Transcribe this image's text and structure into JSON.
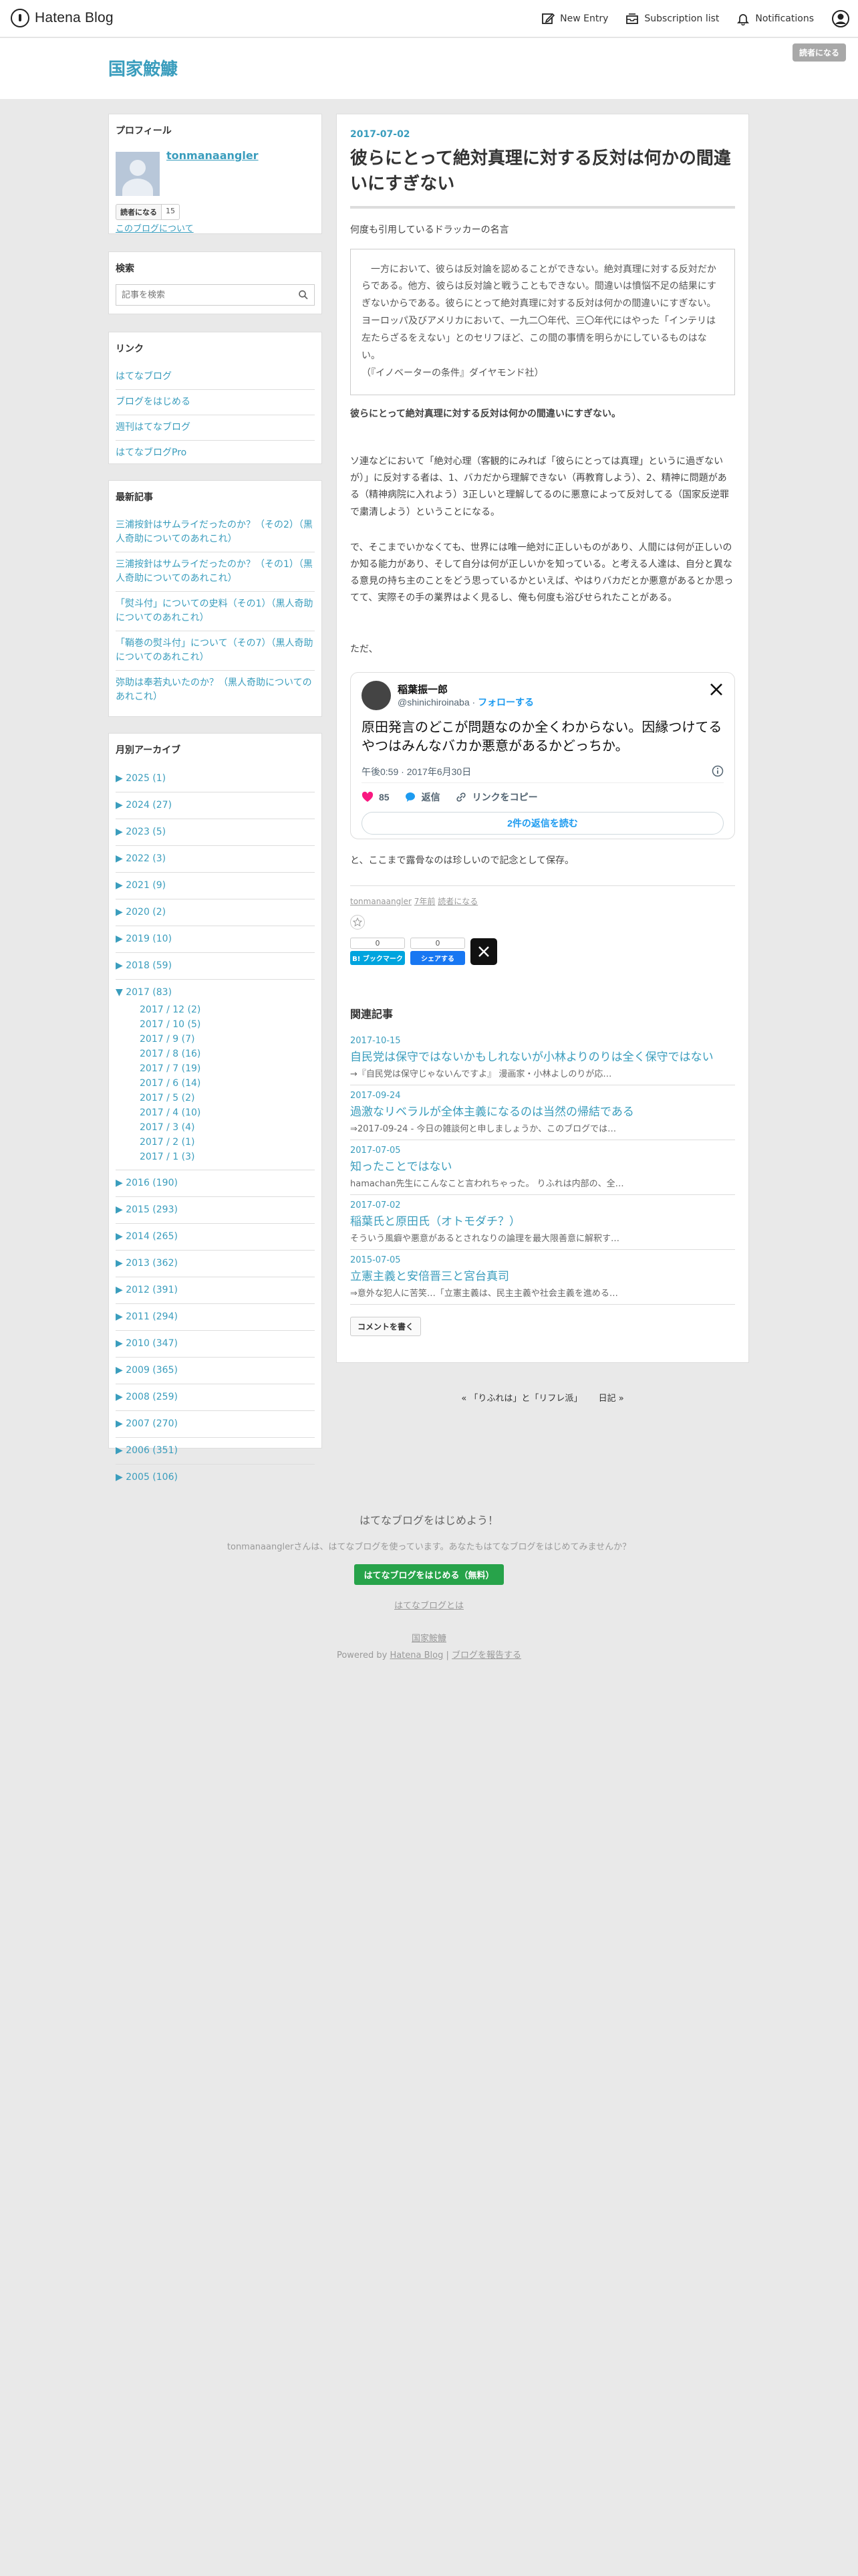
{
  "global_header": {
    "brand": "Hatena Blog",
    "nav": {
      "new_entry": "New Entry",
      "subscription_list": "Subscription list",
      "notifications": "Notifications"
    }
  },
  "blog": {
    "title": "国家鮟鱇",
    "subscribe_button": "読者になる"
  },
  "sidebar": {
    "profile": {
      "heading": "プロフィール",
      "username": "tonmanaangler",
      "follow_label": "読者になる",
      "follow_count": "15",
      "about_link": "このブログについて"
    },
    "search": {
      "heading": "検索",
      "placeholder": "記事を検索"
    },
    "links": {
      "heading": "リンク",
      "items": [
        "はてなブログ",
        "ブログをはじめる",
        "週刊はてなブログ",
        "はてなブログPro"
      ]
    },
    "recent": {
      "heading": "最新記事",
      "items": [
        "三浦按針はサムライだったのか？（その2）（黒人奇助についてのあれこれ）",
        "三浦按針はサムライだったのか？（その1）（黒人奇助についてのあれこれ）",
        "「熨斗付」についての史料（その1）（黒人奇助についてのあれこれ）",
        "「鞘巻の熨斗付」について（その7）（黒人奇助についてのあれこれ）",
        "弥助は奉若丸いたのか？（黒人奇助についてのあれこれ）"
      ]
    },
    "archive": {
      "heading": "月別アーカイブ",
      "years_before": [
        "▶ 2025 (1)",
        "▶ 2024 (27)",
        "▶ 2023 (5)",
        "▶ 2022 (3)",
        "▶ 2021 (9)",
        "▶ 2020 (2)",
        "▶ 2019 (10)",
        "▶ 2018 (59)"
      ],
      "open_year": "▼ 2017 (83)",
      "months": [
        "2017 / 12 (2)",
        "2017 / 10 (5)",
        "2017 / 9 (7)",
        "2017 / 8 (16)",
        "2017 / 7 (19)",
        "2017 / 6 (14)",
        "2017 / 5 (2)",
        "2017 / 4 (10)",
        "2017 / 3 (4)",
        "2017 / 2 (1)",
        "2017 / 1 (3)"
      ],
      "years_after": [
        "▶ 2016 (190)",
        "▶ 2015 (293)",
        "▶ 2014 (265)",
        "▶ 2013 (362)",
        "▶ 2012 (391)",
        "▶ 2011 (294)",
        "▶ 2010 (347)",
        "▶ 2009 (365)",
        "▶ 2008 (259)",
        "▶ 2007 (270)",
        "▶ 2006 (351)",
        "▶ 2005 (106)"
      ]
    }
  },
  "article": {
    "date": "2017-07-02",
    "title": "彼らにとって絶対真理に対する反対は何かの間違いにすぎない",
    "intro": "何度も引用しているドラッカーの名言",
    "quote_lines": [
      "　一方において、彼らは反対論を認めることができない。絶対真理に対する反対だからである。他方、彼らは反対論と戦うこともできない。間違いは憤悩不足の結果にすぎないからである。彼らにとって絶対真理に対する反対は何かの間違いにすぎない。ヨーロッパ及びアメリカにおいて、一九二〇年代、三〇年代にはやった「インテリは左たらざるをえない」とのセリフほど、この間の事情を明らかにしているものはない。",
      "（『イノベーターの条件』ダイヤモンド社）"
    ],
    "emphasis": "彼らにとって絶対真理に対する反対は何かの間違いにすぎない。",
    "p1": "ソ連などにおいて「絶対心理（客観的にみれば「彼らにとっては真理」というに過ぎないが）」に反対する者は、1、バカだから理解できない（再教育しよう）、2、精神に問題がある（精神病院に入れよう）3正しいと理解してるのに悪意によって反対してる（国家反逆罪で粛清しよう）ということになる。",
    "p2": "で、そこまでいかなくても、世界には唯一絶対に正しいものがあり、人間には何が正しいのか知る能力があり、そして自分は何が正しいかを知っている。と考える人達は、自分と異なる意見の持ち主のことをどう思っているかといえば、やはりバカだとか悪意があるとか思ってて、実際その手の業界はよく見るし、俺も何度も浴びせられたことがある。",
    "p3": "ただ、",
    "tweet": {
      "name": "稲葉振一郎",
      "handle": "@shinichiroinaba",
      "follow": "フォローする",
      "text": "原田発言のどこが問題なのか全くわからない。因縁つけてるやつはみんなバカか悪意があるかどっちか。",
      "time": "午後0:59 · 2017年6月30日",
      "likes": "85",
      "reply": "返信",
      "copy_link": "リンクをコピー",
      "read_replies": "2件の返信を読む"
    },
    "p4": "と、ここまで露骨なのは珍しいので記念として保存。",
    "meta": {
      "author": "tonmanaangler",
      "ago": "7年前",
      "reader": "読者になる"
    },
    "share": {
      "hatena_count": "0",
      "hatena_label": "B! ブックマーク",
      "facebook_count": "0",
      "facebook_label": "シェアする"
    },
    "related": {
      "heading": "関連記事",
      "items": [
        {
          "date": "2017-10-15",
          "title": "自民党は保守ではないかもしれないが小林よりのりは全く保守ではない",
          "snippet": "→『自民党は保守じゃないんですよ』 漫画家・小林よしのりが応…"
        },
        {
          "date": "2017-09-24",
          "title": "過激なリベラルが全体主義になるのは当然の帰結である",
          "snippet": "⇒2017-09-24 - 今日の雑談何と申しましょうか、このブログでは…"
        },
        {
          "date": "2017-07-05",
          "title": "知ったことではない",
          "snippet": "hamachan先生にこんなこと言われちゃった。 りふれは内部の、全…"
        },
        {
          "date": "2017-07-02",
          "title": "稲葉氏と原田氏（オトモダチ？）",
          "snippet": "そういう風癖や悪意があるとされなりの論理を最大限善意に解釈す…"
        },
        {
          "date": "2015-07-05",
          "title": "立憲主義と安倍晋三と宮台真司",
          "snippet": "⇒意外な犯人に苦笑…「立憲主義は、民主主義や社会主義を進める…"
        }
      ],
      "comment_button": "コメントを書く"
    }
  },
  "pager": {
    "prev": "« 「りふれは」と「リフレ派」",
    "next": "日記 »"
  },
  "footer": {
    "cta_heading": "はてなブログをはじめよう！",
    "cta_text": "tonmanaanglerさんは、はてなブログを使っています。あなたもはてなブログをはじめてみませんか？",
    "cta_button": "はてなブログをはじめる（無料）",
    "about": "はてなブログとは",
    "blog_link": "国家鮟鱇",
    "powered_prefix": "Powered by ",
    "powered_link": "Hatena Blog",
    "report_link": "ブログを報告する"
  },
  "colors": {
    "accent": "#3a9dbd",
    "cta_green": "#27a34a",
    "hatena_blue": "#00a4de",
    "facebook_blue": "#1877f2"
  }
}
